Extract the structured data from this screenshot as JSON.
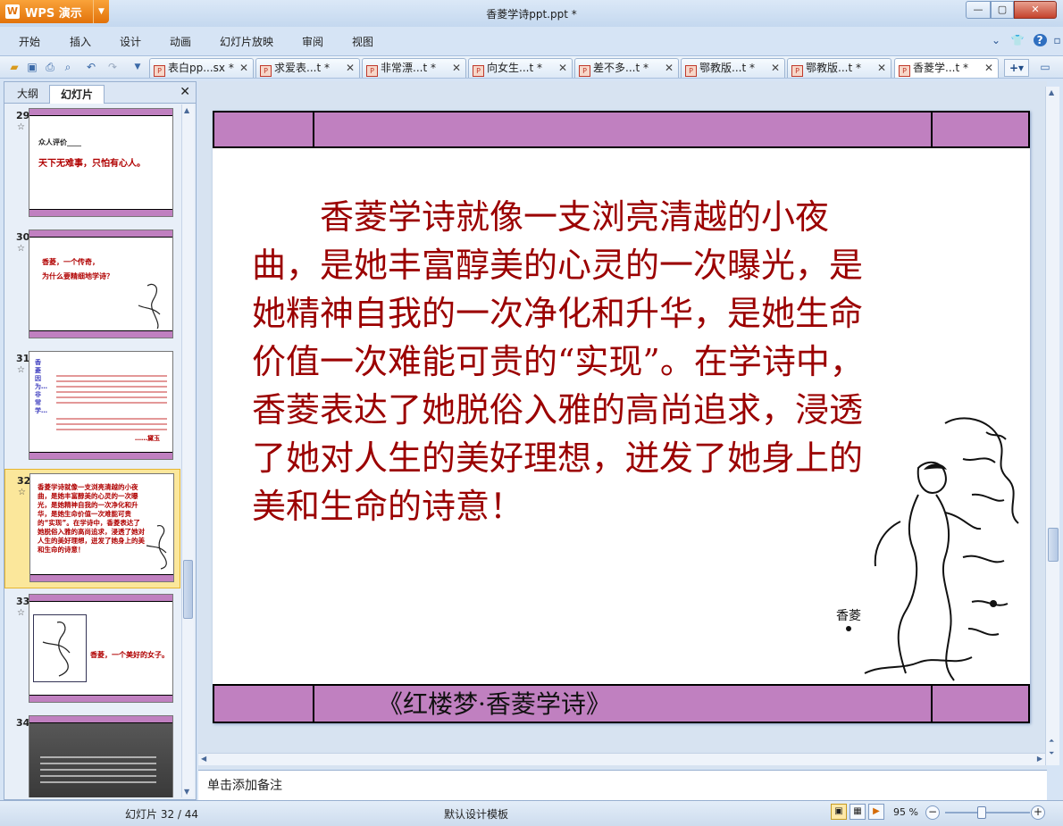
{
  "app": {
    "button_label": "WPS 演示",
    "logo_glyph": "W",
    "window_title": "香菱学诗ppt.ppt *"
  },
  "window_controls": {
    "minimize": "—",
    "maximize": "▢",
    "close": "✕"
  },
  "menu": {
    "items": [
      "开始",
      "插入",
      "设计",
      "动画",
      "幻灯片放映",
      "审阅",
      "视图"
    ],
    "right_icons": [
      "chevron-down-icon",
      "shirt-icon",
      "help-icon"
    ]
  },
  "toolbar": {
    "icons": [
      "open-icon",
      "save-icon",
      "print-icon",
      "print-preview-icon",
      "undo-icon",
      "redo-icon",
      "customize-icon"
    ]
  },
  "tabs": [
    {
      "label": "表白pp...sx *"
    },
    {
      "label": "求爱表...t *"
    },
    {
      "label": "非常漂...t *"
    },
    {
      "label": "向女生...t *"
    },
    {
      "label": "差不多...t *"
    },
    {
      "label": "鄂教版...t *"
    },
    {
      "label": "鄂教版...t *"
    },
    {
      "label": "香菱学...t *"
    }
  ],
  "panel": {
    "tab_outline": "大纲",
    "tab_slides": "幻灯片",
    "close": "✕"
  },
  "thumbnails": [
    {
      "num": "29",
      "line1": "众人评价____",
      "line2": "天下无难事，只怕有心人。"
    },
    {
      "num": "30",
      "line1": "香菱，一个传奇，",
      "line2": "为什么要精细地学诗？"
    },
    {
      "num": "31",
      "line1": "香菱因为…非常学…",
      "line2": "……黛玉"
    },
    {
      "num": "32",
      "line1": "香菱学诗就像一支浏亮清越的小夜曲，是她丰富醇美的心灵的一次曝光，是她精神自我的一次净化和升华，是她生命价值一次难能可贵的“实现”。在学诗中，香菱表达了她脱俗入雅的高尚追求，浸透了她对人生的美好理想，迸发了她身上的美和生命的诗意！",
      "line2": ""
    },
    {
      "num": "33",
      "line1": "香菱，一个美好的女子。",
      "line2": ""
    },
    {
      "num": "34",
      "line1": "",
      "line2": ""
    }
  ],
  "slide": {
    "body_text": "　　香菱学诗就像一支浏亮清越的小夜曲，是她丰富醇美的心灵的一次曝光，是她精神自我的一次净化和升华，是她生命价值一次难能可贵的“实现”。在学诗中，香菱表达了她脱俗入雅的高尚追求，浸透了她对人生的美好理想，迸发了她身上的美和生命的诗意！",
    "caption": "《红楼梦·香菱学诗》",
    "band_color": "#c080c0",
    "text_color": "#9b0000"
  },
  "notes": {
    "placeholder": "单击添加备注"
  },
  "status": {
    "slide_info": "幻灯片 32 / 44",
    "template": "默认设计模板",
    "zoom": "95 %"
  }
}
